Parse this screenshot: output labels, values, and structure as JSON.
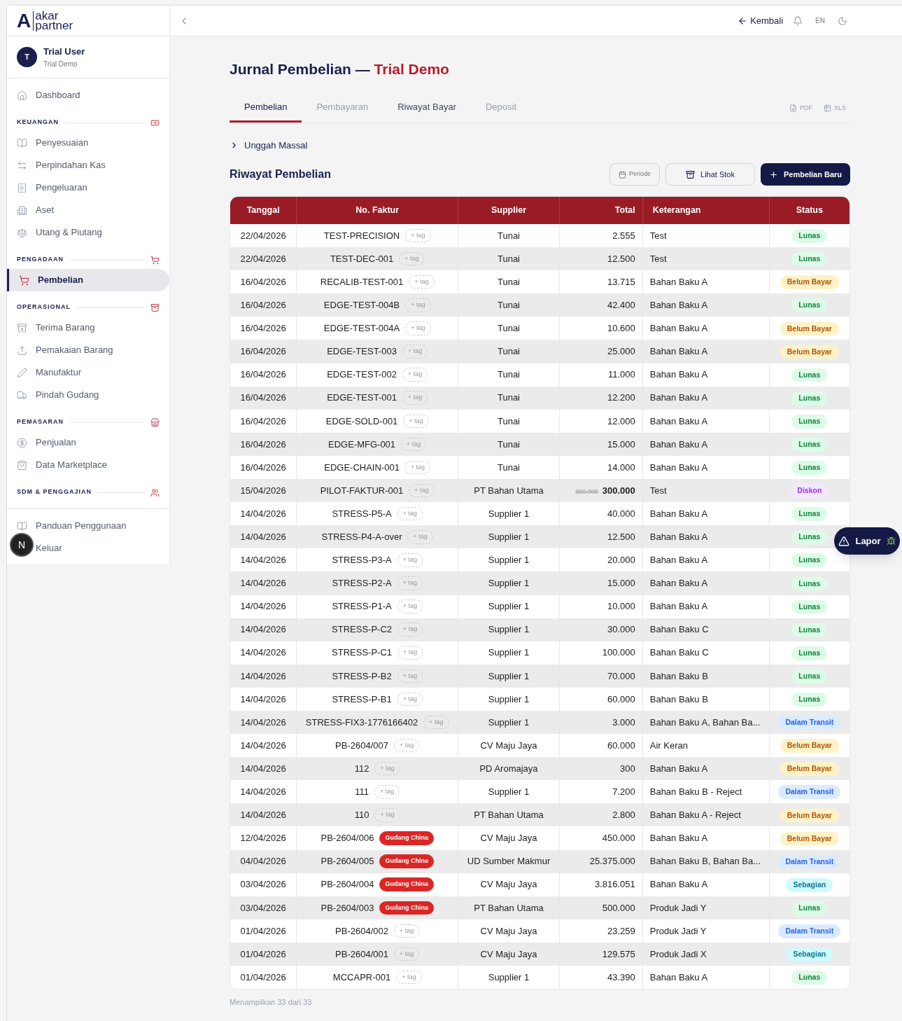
{
  "brand": {
    "mark": "A",
    "line1": "akar",
    "line2": "partner"
  },
  "user": {
    "initial": "T",
    "name": "Trial User",
    "org": "Trial Demo"
  },
  "sidebar": {
    "top": [
      {
        "label": "Dashboard",
        "selected": false
      }
    ],
    "sections": [
      {
        "heading": "KEUANGAN",
        "items": [
          {
            "label": "Penyesuaian",
            "selected": false
          },
          {
            "label": "Perpindahan Kas",
            "selected": false
          },
          {
            "label": "Pengeluaran",
            "selected": false
          },
          {
            "label": "Aset",
            "selected": false
          },
          {
            "label": "Utang & Piutang",
            "selected": false
          }
        ]
      },
      {
        "heading": "PENGADAAN",
        "items": [
          {
            "label": "Pembelian",
            "selected": true
          }
        ]
      },
      {
        "heading": "OPERASIONAL",
        "items": [
          {
            "label": "Terima Barang",
            "selected": false
          },
          {
            "label": "Pemakaian Barang",
            "selected": false
          },
          {
            "label": "Manufaktur",
            "selected": false
          },
          {
            "label": "Pindah Gudang",
            "selected": false
          }
        ]
      },
      {
        "heading": "PEMASARAN",
        "items": [
          {
            "label": "Penjualan",
            "selected": false
          },
          {
            "label": "Data Marketplace",
            "selected": false
          }
        ]
      },
      {
        "heading": "SDM & PENGGAJIAN"
      }
    ],
    "footer": [
      {
        "label": "Panduan Penggunaan"
      },
      {
        "label": "Keluar"
      }
    ]
  },
  "dev_badge": "N",
  "topbar": {
    "back": "Kembali",
    "language": "EN"
  },
  "page": {
    "title": "Jurnal Pembelian —",
    "title_accent": "Trial Demo"
  },
  "tabs": [
    {
      "label": "Pembelian",
      "selected": true,
      "disabled": false
    },
    {
      "label": "Pembayaran",
      "selected": false,
      "disabled": true
    },
    {
      "label": "Riwayat Bayar",
      "selected": false,
      "disabled": false
    },
    {
      "label": "Deposit",
      "selected": false,
      "disabled": true
    }
  ],
  "exports": [
    "PDF",
    "XLS"
  ],
  "bulk_upload": {
    "label": "Unggah Massal",
    "expanded": false
  },
  "section_title": "Riwayat Pembelian",
  "actions": {
    "period": "Periode",
    "stock": "Lihat Stok",
    "new": "Pembelian Baru"
  },
  "table": {
    "columns": [
      "Tanggal",
      "No. Faktur",
      "Supplier",
      "Total",
      "Keterangan",
      "Status"
    ],
    "rows": [
      {
        "date": "22/04/2026",
        "invoice": "TEST-PRECISION",
        "tag": {
          "kind": "add",
          "label": "+ tag"
        },
        "supplier": "Tunai",
        "total": "2.555",
        "note": "Test",
        "status": {
          "kind": "lunas",
          "label": "Lunas"
        }
      },
      {
        "date": "22/04/2026",
        "invoice": "TEST-DEC-001",
        "tag": {
          "kind": "add",
          "label": "+ tag"
        },
        "supplier": "Tunai",
        "total": "12.500",
        "note": "Test",
        "status": {
          "kind": "lunas",
          "label": "Lunas"
        }
      },
      {
        "date": "16/04/2026",
        "invoice": "RECALIB-TEST-001",
        "tag": {
          "kind": "add",
          "label": "+ tag"
        },
        "supplier": "Tunai",
        "total": "13.715",
        "note": "Bahan Baku A",
        "status": {
          "kind": "belum",
          "label": "Belum Bayar"
        }
      },
      {
        "date": "16/04/2026",
        "invoice": "EDGE-TEST-004B",
        "tag": {
          "kind": "add",
          "label": "+ tag"
        },
        "supplier": "Tunai",
        "total": "42.400",
        "note": "Bahan Baku A",
        "status": {
          "kind": "lunas",
          "label": "Lunas"
        }
      },
      {
        "date": "16/04/2026",
        "invoice": "EDGE-TEST-004A",
        "tag": {
          "kind": "add",
          "label": "+ tag"
        },
        "supplier": "Tunai",
        "total": "10.600",
        "note": "Bahan Baku A",
        "status": {
          "kind": "belum",
          "label": "Belum Bayar"
        }
      },
      {
        "date": "16/04/2026",
        "invoice": "EDGE-TEST-003",
        "tag": {
          "kind": "add",
          "label": "+ tag"
        },
        "supplier": "Tunai",
        "total": "25.000",
        "note": "Bahan Baku A",
        "status": {
          "kind": "belum",
          "label": "Belum Bayar"
        }
      },
      {
        "date": "16/04/2026",
        "invoice": "EDGE-TEST-002",
        "tag": {
          "kind": "add",
          "label": "+ tag"
        },
        "supplier": "Tunai",
        "total": "11.000",
        "note": "Bahan Baku A",
        "status": {
          "kind": "lunas",
          "label": "Lunas"
        }
      },
      {
        "date": "16/04/2026",
        "invoice": "EDGE-TEST-001",
        "tag": {
          "kind": "add",
          "label": "+ tag"
        },
        "supplier": "Tunai",
        "total": "12.200",
        "note": "Bahan Baku A",
        "status": {
          "kind": "lunas",
          "label": "Lunas"
        }
      },
      {
        "date": "16/04/2026",
        "invoice": "EDGE-SOLD-001",
        "tag": {
          "kind": "add",
          "label": "+ tag"
        },
        "supplier": "Tunai",
        "total": "12.000",
        "note": "Bahan Baku A",
        "status": {
          "kind": "lunas",
          "label": "Lunas"
        }
      },
      {
        "date": "16/04/2026",
        "invoice": "EDGE-MFG-001",
        "tag": {
          "kind": "add",
          "label": "+ tag"
        },
        "supplier": "Tunai",
        "total": "15.000",
        "note": "Bahan Baku A",
        "status": {
          "kind": "lunas",
          "label": "Lunas"
        }
      },
      {
        "date": "16/04/2026",
        "invoice": "EDGE-CHAIN-001",
        "tag": {
          "kind": "add",
          "label": "+ tag"
        },
        "supplier": "Tunai",
        "total": "14.000",
        "note": "Bahan Baku A",
        "status": {
          "kind": "lunas",
          "label": "Lunas"
        }
      },
      {
        "date": "15/04/2026",
        "invoice": "PILOT-FAKTUR-001",
        "tag": {
          "kind": "add",
          "label": "+ tag"
        },
        "supplier": "PT Bahan Utama",
        "original_total": "300.000",
        "total": "300.000",
        "note": "Test",
        "status": {
          "kind": "diskon",
          "label": "Diskon"
        }
      },
      {
        "date": "14/04/2026",
        "invoice": "STRESS-P5-A",
        "tag": {
          "kind": "add",
          "label": "+ tag"
        },
        "supplier": "Supplier 1",
        "total": "40.000",
        "note": "Bahan Baku A",
        "status": {
          "kind": "lunas",
          "label": "Lunas"
        }
      },
      {
        "date": "14/04/2026",
        "invoice": "STRESS-P4-A-over",
        "tag": {
          "kind": "add",
          "label": "+ tag"
        },
        "supplier": "Supplier 1",
        "total": "12.500",
        "note": "Bahan Baku A",
        "status": {
          "kind": "lunas",
          "label": "Lunas"
        }
      },
      {
        "date": "14/04/2026",
        "invoice": "STRESS-P3-A",
        "tag": {
          "kind": "add",
          "label": "+ tag"
        },
        "supplier": "Supplier 1",
        "total": "20.000",
        "note": "Bahan Baku A",
        "status": {
          "kind": "lunas",
          "label": "Lunas"
        }
      },
      {
        "date": "14/04/2026",
        "invoice": "STRESS-P2-A",
        "tag": {
          "kind": "add",
          "label": "+ tag"
        },
        "supplier": "Supplier 1",
        "total": "15.000",
        "note": "Bahan Baku A",
        "status": {
          "kind": "lunas",
          "label": "Lunas"
        }
      },
      {
        "date": "14/04/2026",
        "invoice": "STRESS-P1-A",
        "tag": {
          "kind": "add",
          "label": "+ tag"
        },
        "supplier": "Supplier 1",
        "total": "10.000",
        "note": "Bahan Baku A",
        "status": {
          "kind": "lunas",
          "label": "Lunas"
        }
      },
      {
        "date": "14/04/2026",
        "invoice": "STRESS-P-C2",
        "tag": {
          "kind": "add",
          "label": "+ tag"
        },
        "supplier": "Supplier 1",
        "total": "30.000",
        "note": "Bahan Baku C",
        "status": {
          "kind": "lunas",
          "label": "Lunas"
        }
      },
      {
        "date": "14/04/2026",
        "invoice": "STRESS-P-C1",
        "tag": {
          "kind": "add",
          "label": "+ tag"
        },
        "supplier": "Supplier 1",
        "total": "100.000",
        "note": "Bahan Baku C",
        "status": {
          "kind": "lunas",
          "label": "Lunas"
        }
      },
      {
        "date": "14/04/2026",
        "invoice": "STRESS-P-B2",
        "tag": {
          "kind": "add",
          "label": "+ tag"
        },
        "supplier": "Supplier 1",
        "total": "70.000",
        "note": "Bahan Baku B",
        "status": {
          "kind": "lunas",
          "label": "Lunas"
        }
      },
      {
        "date": "14/04/2026",
        "invoice": "STRESS-P-B1",
        "tag": {
          "kind": "add",
          "label": "+ tag"
        },
        "supplier": "Supplier 1",
        "total": "60.000",
        "note": "Bahan Baku B",
        "status": {
          "kind": "lunas",
          "label": "Lunas"
        }
      },
      {
        "date": "14/04/2026",
        "invoice": "STRESS-FIX3-1776166402",
        "tag": {
          "kind": "add",
          "label": "+ tag"
        },
        "supplier": "Supplier 1",
        "total": "3.000",
        "note": "Bahan Baku A, Bahan Ba...",
        "status": {
          "kind": "transit",
          "label": "Dalam Transit"
        }
      },
      {
        "date": "14/04/2026",
        "invoice": "PB-2604/007",
        "tag": {
          "kind": "add",
          "label": "+ tag"
        },
        "supplier": "CV Maju Jaya",
        "total": "60.000",
        "note": "Air Keran",
        "status": {
          "kind": "belum",
          "label": "Belum Bayar"
        }
      },
      {
        "date": "14/04/2026",
        "invoice": "112",
        "tag": {
          "kind": "add",
          "label": "+ tag"
        },
        "supplier": "PD Aromajaya",
        "total": "300",
        "note": "Bahan Baku A",
        "status": {
          "kind": "belum",
          "label": "Belum Bayar"
        }
      },
      {
        "date": "14/04/2026",
        "invoice": "111",
        "tag": {
          "kind": "add",
          "label": "+ tag"
        },
        "supplier": "Supplier 1",
        "total": "7.200",
        "note": "Bahan Baku B - Reject",
        "status": {
          "kind": "transit",
          "label": "Dalam Transit"
        }
      },
      {
        "date": "14/04/2026",
        "invoice": "110",
        "tag": {
          "kind": "add",
          "label": "+ tag"
        },
        "supplier": "PT Bahan Utama",
        "total": "2.800",
        "note": "Bahan Baku A - Reject",
        "status": {
          "kind": "belum",
          "label": "Belum Bayar"
        }
      },
      {
        "date": "12/04/2026",
        "invoice": "PB-2604/006",
        "tag": {
          "kind": "warehouse",
          "label": "Gudang China"
        },
        "supplier": "CV Maju Jaya",
        "total": "450.000",
        "note": "Bahan Baku A",
        "status": {
          "kind": "belum",
          "label": "Belum Bayar"
        }
      },
      {
        "date": "04/04/2026",
        "invoice": "PB-2604/005",
        "tag": {
          "kind": "warehouse",
          "label": "Gudang China"
        },
        "supplier": "UD Sumber Makmur",
        "total": "25.375.000",
        "note": "Bahan Baku B, Bahan Ba...",
        "status": {
          "kind": "transit",
          "label": "Dalam Transit"
        }
      },
      {
        "date": "03/04/2026",
        "invoice": "PB-2604/004",
        "tag": {
          "kind": "warehouse",
          "label": "Gudang China"
        },
        "supplier": "CV Maju Jaya",
        "total": "3.816.051",
        "note": "Bahan Baku A",
        "status": {
          "kind": "sebagian",
          "label": "Sebagian"
        }
      },
      {
        "date": "03/04/2026",
        "invoice": "PB-2604/003",
        "tag": {
          "kind": "warehouse",
          "label": "Gudang China"
        },
        "supplier": "PT Bahan Utama",
        "total": "500.000",
        "note": "Produk Jadi Y",
        "status": {
          "kind": "lunas",
          "label": "Lunas"
        }
      },
      {
        "date": "01/04/2026",
        "invoice": "PB-2604/002",
        "tag": {
          "kind": "add",
          "label": "+ tag"
        },
        "supplier": "CV Maju Jaya",
        "total": "23.259",
        "note": "Produk Jadi Y",
        "status": {
          "kind": "transit",
          "label": "Dalam Transit"
        }
      },
      {
        "date": "01/04/2026",
        "invoice": "PB-2604/001",
        "tag": {
          "kind": "add",
          "label": "+ tag"
        },
        "supplier": "CV Maju Jaya",
        "total": "129.575",
        "note": "Produk Jadi X",
        "status": {
          "kind": "sebagian",
          "label": "Sebagian"
        }
      },
      {
        "date": "01/04/2026",
        "invoice": "MCCAPR-001",
        "tag": {
          "kind": "add",
          "label": "+ tag"
        },
        "supplier": "Supplier 1",
        "total": "43.390",
        "note": "Bahan Baku A",
        "status": {
          "kind": "lunas",
          "label": "Lunas"
        }
      }
    ]
  },
  "footer_note": "Menampilkan 33 dari 33",
  "report_button": "Lapor"
}
